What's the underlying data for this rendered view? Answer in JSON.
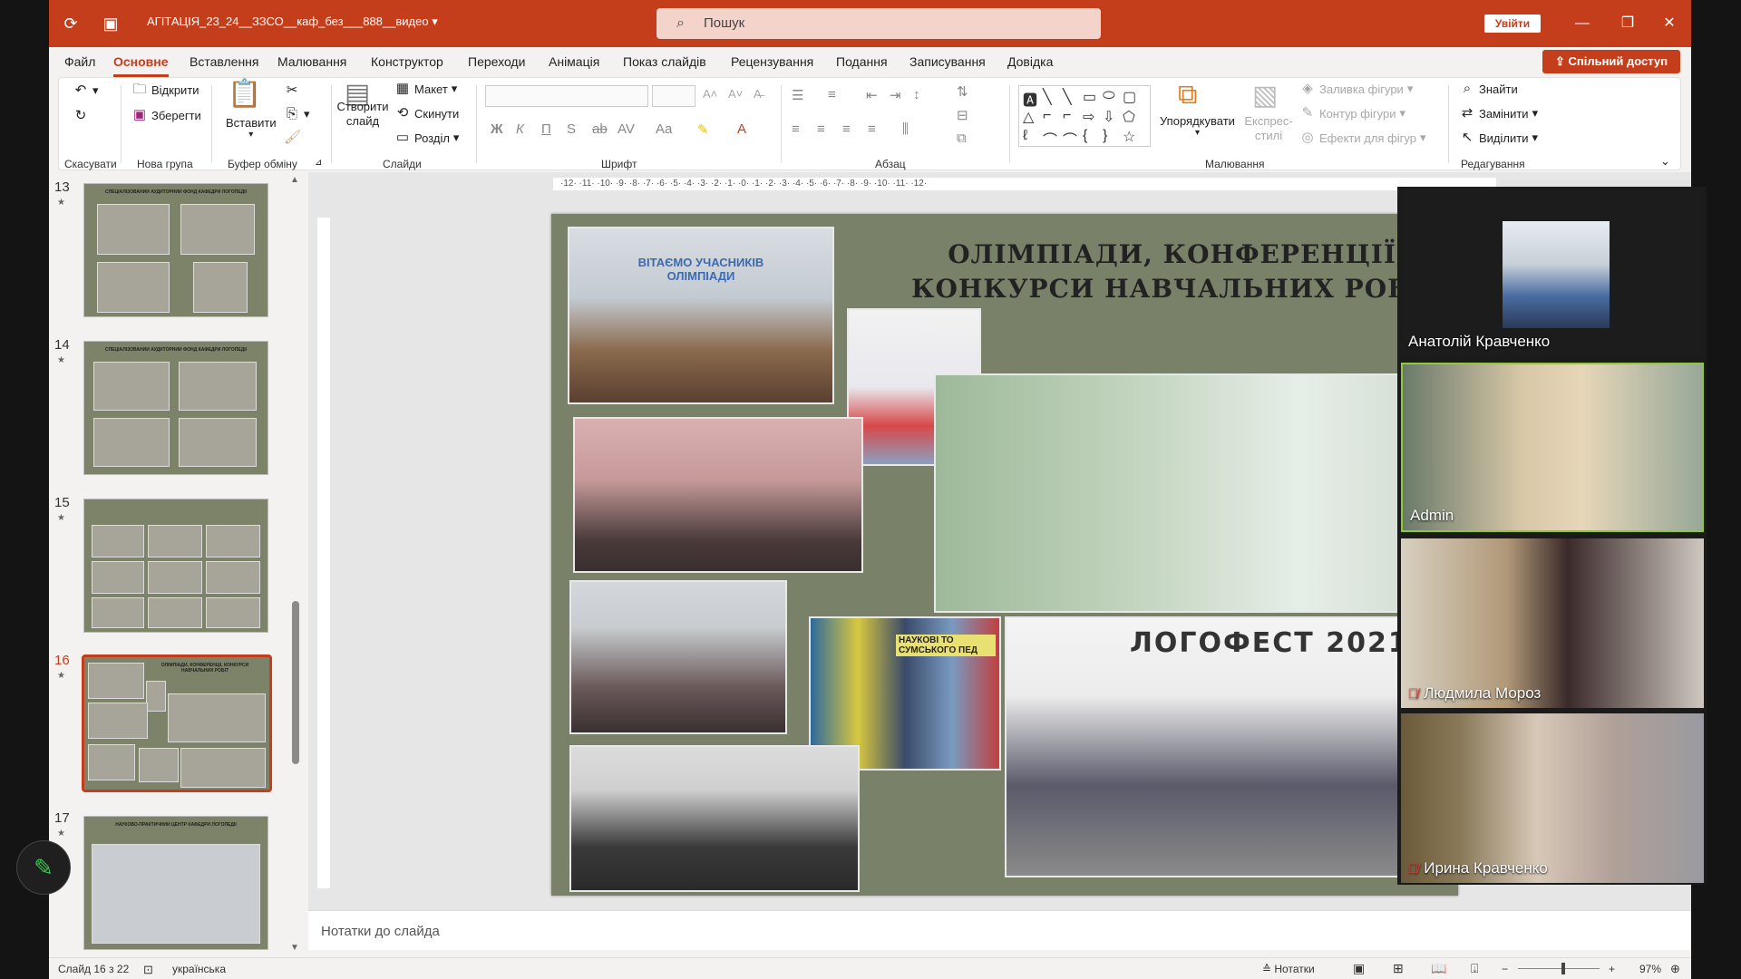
{
  "titlebar": {
    "doc_title": "АГІТАЦІЯ_23_24__ЗЗСО__каф_без___888__видео",
    "search_placeholder": "Пошук",
    "signin": "Увійти"
  },
  "menu": [
    "Файл",
    "Основне",
    "Вставлення",
    "Малювання",
    "Конструктор",
    "Переходи",
    "Анімація",
    "Показ слайдів",
    "Рецензування",
    "Подання",
    "Записування",
    "Довідка"
  ],
  "active_menu": "Основне",
  "share_label": "Спільний доступ",
  "ribbon": {
    "groups": {
      "undo": "Скасувати",
      "new_group": "Нова група",
      "clipboard": "Буфер обміну",
      "slides": "Слайди",
      "font": "Шрифт",
      "paragraph": "Абзац",
      "drawing": "Малювання",
      "editing": "Редагування"
    },
    "open": "Відкрити",
    "save": "Зберегти",
    "paste": "Вставити",
    "new_slide": "Створити слайд",
    "layout": "Макет",
    "reset": "Скинути",
    "section": "Розділ",
    "arrange": "Упорядкувати",
    "quick_styles": "Експрес-стилі",
    "shape_fill": "Заливка фігури",
    "shape_outline": "Контур фігури",
    "shape_effects": "Ефекти для фігур",
    "find": "Знайти",
    "replace": "Замінити",
    "select": "Виділити",
    "font_buttons": [
      "Ж",
      "К",
      "П",
      "S",
      "ab",
      "AV",
      "Aa"
    ]
  },
  "thumbnails": [
    {
      "num": "13",
      "title": "СПЕЦІАЛІЗОВАНИЙ АУДИТОРНИЙ ФОНД КАФЕДРИ ЛОГОПЕДІЇ"
    },
    {
      "num": "14",
      "title": "СПЕЦІАЛІЗОВАНИЙ АУДИТОРНИЙ ФОНД КАФЕДРИ ЛОГОПЕДІЇ"
    },
    {
      "num": "15",
      "title": ""
    },
    {
      "num": "16",
      "title": "ОЛІМПІАДИ, КОНФЕРЕНЦІЇ, КОНКУРСИ НАВЧАЛЬНИХ РОБІТ"
    },
    {
      "num": "17",
      "title": "НАУКОВО-ПРАКТИЧНИЙ ЦЕНТР КАФЕДРИ ЛОГОПЕДІЇ"
    }
  ],
  "selected_slide": "16",
  "slide": {
    "title_line1": "ОЛІМПІАДИ, КОНФЕРЕНЦІЇ,",
    "title_line2": "КОНКУРСИ НАВЧАЛЬНИХ РОБІТ",
    "banner_text": "ВІТАЄМО УЧАСНИКІВ ОЛІМПІАДИ",
    "logofest": "ЛОГОФЕСТ 2021",
    "books_text": "НАУКОВІ ТО СУМСЬКОГО ПЕД"
  },
  "notes_placeholder": "Нотатки до слайда",
  "status": {
    "slide_info": "Слайд 16 з 22",
    "language": "українська",
    "notes_label": "Нотатки",
    "zoom": "97%"
  },
  "participants": [
    {
      "name": "Анатолій Кравченко",
      "muted": false
    },
    {
      "name": "Admin",
      "muted": false
    },
    {
      "name": "Людмила Мороз",
      "muted": true
    },
    {
      "name": "Ирина Кравченко",
      "muted": true
    }
  ],
  "colors": {
    "accent": "#c43e1c",
    "slide_bg": "#7a8169",
    "speaking": "#8fc93a"
  }
}
